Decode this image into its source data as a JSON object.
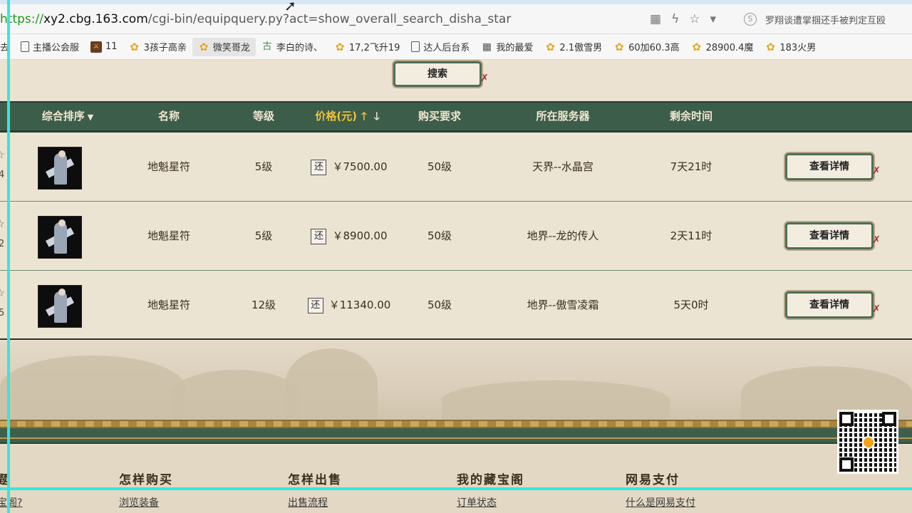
{
  "browser": {
    "url_scheme": "https://",
    "url_host": "xy2.cbg.163.com",
    "url_path": "/cgi-bin/equipquery.py?act=show_overall_search_disha_star",
    "news_text": "罗翔谈遭掌掴还手被判定互殴"
  },
  "bookmarks": [
    {
      "label": "去",
      "icon": "none"
    },
    {
      "label": "主播公会服",
      "icon": "doc-icon"
    },
    {
      "label": "11",
      "icon": "game-icon"
    },
    {
      "label": "3孩子高亲",
      "icon": "duck-icon"
    },
    {
      "label": "微笑哥龙",
      "icon": "duck-icon"
    },
    {
      "label": "李白的诗、",
      "icon": "bai-icon"
    },
    {
      "label": "17,2飞升19",
      "icon": "duck-icon"
    },
    {
      "label": "达人后台系",
      "icon": "doc-icon"
    },
    {
      "label": "我的最爱",
      "icon": "grid-icon"
    },
    {
      "label": "2.1傲雪男",
      "icon": "duck-icon"
    },
    {
      "label": "60加60.3高",
      "icon": "duck-icon"
    },
    {
      "label": "28900.4魔",
      "icon": "duck-icon"
    },
    {
      "label": "183火男",
      "icon": "duck-icon"
    }
  ],
  "search": {
    "button_label": "搜索"
  },
  "table": {
    "headers": {
      "sort": "综合排序",
      "name": "名称",
      "level": "等级",
      "price": "价格(元)",
      "requirement": "购买要求",
      "server": "所在服务器",
      "time_left": "剩余时间"
    },
    "rows": [
      {
        "name": "地魁星符",
        "level": "5级",
        "rebate": "还",
        "price": "￥7500.00",
        "requirement": "50级",
        "server": "天界--水晶宫",
        "time_left": "7天21时",
        "action": "查看详情",
        "left_digit": "4"
      },
      {
        "name": "地魁星符",
        "level": "5级",
        "rebate": "还",
        "price": "￥8900.00",
        "requirement": "50级",
        "server": "地界--龙的传人",
        "time_left": "2天11时",
        "action": "查看详情",
        "left_digit": "2"
      },
      {
        "name": "地魁星符",
        "level": "12级",
        "rebate": "还",
        "price": "￥11340.00",
        "requirement": "50级",
        "server": "地界--傲雪凌霜",
        "time_left": "5天0时",
        "action": "查看详情",
        "left_digit": "5"
      }
    ]
  },
  "footer": {
    "columns": [
      {
        "title": "题",
        "link": "宝阁?"
      },
      {
        "title": "怎样购买",
        "link": "浏览装备"
      },
      {
        "title": "怎样出售",
        "link": "出售流程"
      },
      {
        "title": "我的藏宝阁",
        "link": "订单状态"
      },
      {
        "title": "网易支付",
        "link": "什么是网易支付"
      }
    ]
  },
  "colors": {
    "header_green": "#3d5d4b",
    "price_gold": "#f0c33a",
    "knot_red": "#b0282a",
    "frame_cyan": "#37e6dc"
  }
}
